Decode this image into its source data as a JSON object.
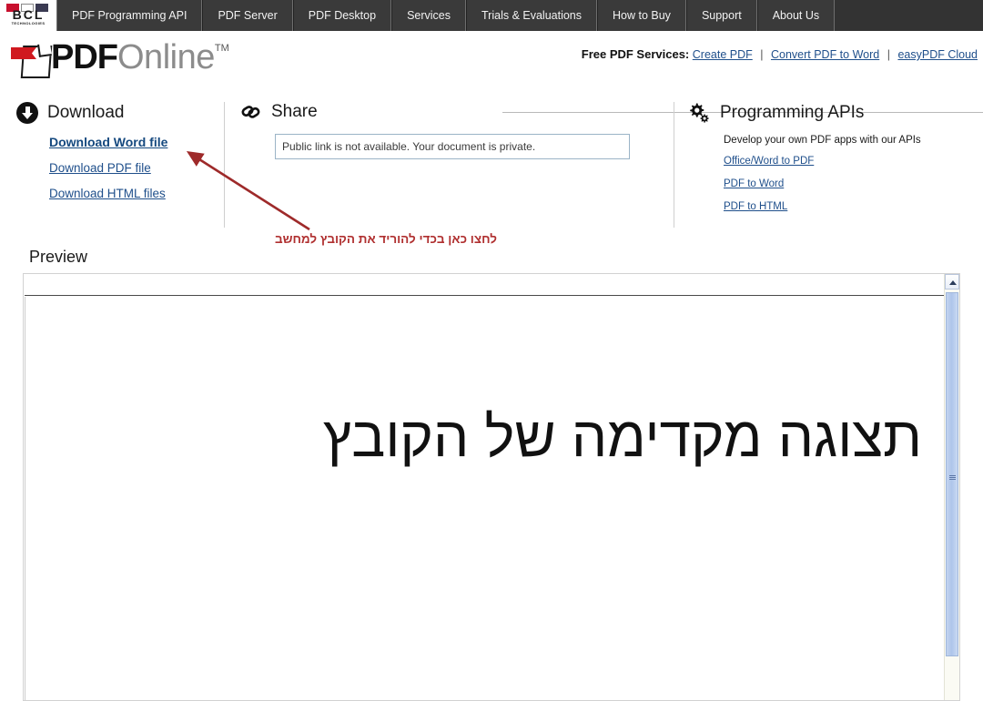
{
  "topnav": {
    "logo": {
      "letters": "BCL",
      "sub": "TECHNOLOGIES"
    },
    "tabs": [
      {
        "label": "PDF Programming API"
      },
      {
        "label": "PDF Server"
      },
      {
        "label": "PDF Desktop"
      },
      {
        "label": "Services"
      },
      {
        "label": "Trials & Evaluations"
      },
      {
        "label": "How to Buy"
      },
      {
        "label": "Support"
      },
      {
        "label": "About Us"
      }
    ]
  },
  "header": {
    "brand_pdf": "PDF",
    "brand_online": "Online",
    "brand_tm": "TM",
    "services_label": "Free PDF Services:",
    "service_links": [
      {
        "label": "Create PDF"
      },
      {
        "label": "Convert PDF to Word"
      },
      {
        "label": "easyPDF Cloud"
      }
    ],
    "separator": "|"
  },
  "download_panel": {
    "title": "Download",
    "links": [
      {
        "label": "Download Word file"
      },
      {
        "label": "Download PDF file"
      },
      {
        "label": "Download HTML files"
      }
    ]
  },
  "share_panel": {
    "title": "Share",
    "input_value": "Public link is not available. Your document is private.",
    "input_placeholder": "Public link is not available. Your document is private."
  },
  "apis_panel": {
    "title": "Programming APIs",
    "subtitle": "Develop your own PDF apps with our APIs",
    "links": [
      {
        "label": "Office/Word to PDF"
      },
      {
        "label": "PDF to Word"
      },
      {
        "label": "PDF to HTML"
      }
    ]
  },
  "annotation": {
    "text": "לחצו כאן בכדי להוריד את הקובץ למחשב",
    "color": "#b03030"
  },
  "preview": {
    "title": "Preview",
    "document_text": "תצוגה מקדימה של הקובץ"
  },
  "colors": {
    "nav_background": "#333333",
    "nav_tab": "#3a3a3a",
    "link": "#1f4f8b",
    "annotation_red": "#b03030",
    "scrollbar_thumb": "#aec5ea"
  }
}
